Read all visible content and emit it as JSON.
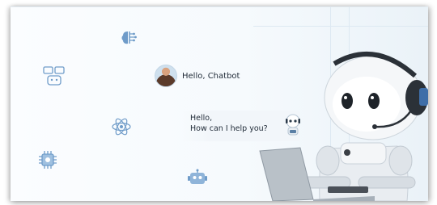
{
  "conversation": {
    "user_message": "Hello, Chatbot",
    "bot_message": "Hello,\nHow can I help you?"
  },
  "icons": {
    "brain": "brain-chip-icon",
    "chat": "chat-bubbles-icon",
    "atom": "atom-icon",
    "chip": "processor-chip-icon",
    "robot": "robot-head-icon",
    "bot_avatar": "mini-robot-icon",
    "user_avatar": "user-avatar"
  },
  "colors": {
    "icon_accent": "#6f9cc9",
    "text": "#1f2a37",
    "bubble": "#f2f6fa"
  }
}
